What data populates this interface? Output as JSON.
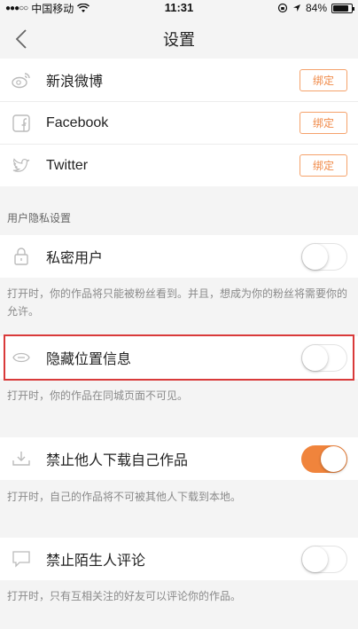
{
  "status": {
    "carrier": "中国移动",
    "time": "11:31",
    "battery": "84%",
    "battery_level": 0.84
  },
  "nav": {
    "title": "设置"
  },
  "accounts": [
    {
      "label": "新浪微博",
      "icon": "weibo-icon",
      "button": "绑定"
    },
    {
      "label": "Facebook",
      "icon": "facebook-icon",
      "button": "绑定"
    },
    {
      "label": "Twitter",
      "icon": "twitter-icon",
      "button": "绑定"
    }
  ],
  "privacy": {
    "header": "用户隐私设置",
    "items": [
      {
        "label": "私密用户",
        "icon": "lock-icon",
        "on": false,
        "desc": "打开时，你的作品将只能被粉丝看到。并且，想成为你的粉丝将需要你的允许。"
      },
      {
        "label": "隐藏位置信息",
        "icon": "location-hide-icon",
        "on": false,
        "desc": "打开时，你的作品在同城页面不可见。"
      },
      {
        "label": "禁止他人下载自己作品",
        "icon": "download-icon",
        "on": true,
        "desc": "打开时，自己的作品将不可被其他人下载到本地。"
      },
      {
        "label": "禁止陌生人评论",
        "icon": "comment-icon",
        "on": false,
        "desc": "打开时，只有互相关注的好友可以评论你的作品。"
      }
    ]
  },
  "colors": {
    "accent": "#f0843c",
    "highlight": "#d93a3a"
  }
}
